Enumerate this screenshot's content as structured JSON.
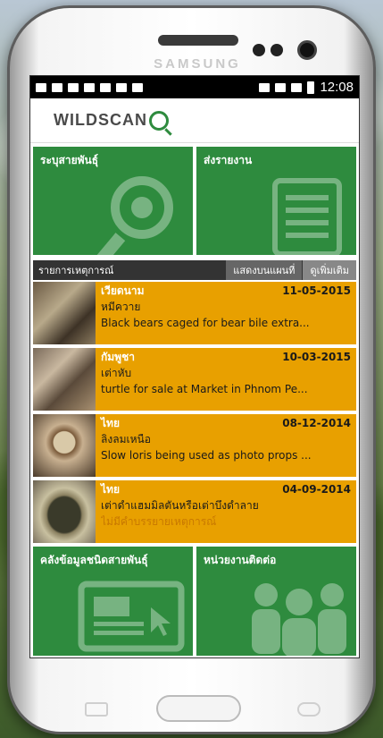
{
  "device": {
    "brand": "SAMSUNG"
  },
  "status_bar": {
    "time": "12:08"
  },
  "app": {
    "logo_text": "WILDSCAN"
  },
  "tiles": {
    "identify_species": "ระบุสายพันธุ์",
    "send_report": "ส่งรายงาน",
    "species_database": "คลังข้อมูลชนิดสายพันธุ์",
    "contacts": "หน่วยงานติดต่อ"
  },
  "incidents_section": {
    "title": "รายการเหตุการณ์",
    "show_on_map": "แสดงบนแผนที่",
    "see_more": "ดูเพิ่มเติม"
  },
  "incidents": [
    {
      "country": "เวียดนาม",
      "date": "11-05-2015",
      "species": "หมีควาย",
      "description": "Black bears caged for bear bile extra..."
    },
    {
      "country": "กัมพูชา",
      "date": "10-03-2015",
      "species": "เต่าหับ",
      "description": "turtle for sale at Market in Phnom Pe..."
    },
    {
      "country": "ไทย",
      "date": "08-12-2014",
      "species": "ลิงลมเหนือ",
      "description": "Slow loris being used as photo props ..."
    },
    {
      "country": "ไทย",
      "date": "04-09-2014",
      "species": "เต่าดำแฮมมิลตันหรือเต่าบึงดำลาย",
      "description": "ไม่มีคำบรรยายเหตุการณ์"
    }
  ],
  "colors": {
    "green": "#2e8b3e",
    "orange": "#e8a000",
    "dark_header": "#333333"
  }
}
